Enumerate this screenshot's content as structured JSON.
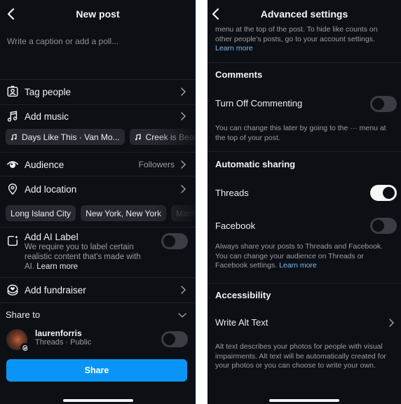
{
  "left": {
    "header": {
      "title": "New post",
      "back_icon": "chevron-left-icon"
    },
    "caption": {
      "placeholder": "Write a caption or add a poll..."
    },
    "rows": {
      "tag_people": {
        "label": "Tag people",
        "icon": "tag-person-icon"
      },
      "add_music": {
        "label": "Add music",
        "icon": "music-note-icon"
      },
      "audience": {
        "label": "Audience",
        "value": "Followers",
        "icon": "eye-icon"
      },
      "add_location": {
        "label": "Add location",
        "icon": "location-pin-icon"
      },
      "ai_label": {
        "label": "Add AI Label",
        "description": "We require you to label certain realistic content that's made with AI.",
        "link": "Learn more",
        "toggle_on": false,
        "icon": "sparkle-square-icon"
      },
      "fundraiser": {
        "label": "Add fundraiser",
        "icon": "fundraiser-icon"
      }
    },
    "music_chips": [
      {
        "label": "Days Like This · Van Mo..."
      },
      {
        "label": "Creek is Beauti"
      }
    ],
    "location_chips": [
      {
        "label": "Long Island City"
      },
      {
        "label": "New York, New York"
      },
      {
        "label": "Manha"
      }
    ],
    "share_to": {
      "label": "Share to",
      "account": {
        "name": "laurenforris",
        "subtitle": "Threads · Public",
        "toggle_on": false
      }
    },
    "share_button": {
      "label": "Share"
    }
  },
  "right": {
    "header": {
      "title": "Advanced settings",
      "back_icon": "chevron-left-icon"
    },
    "top_text": "menu at the top of the post. To hide like counts on other people's posts, go to your account settings.",
    "top_link": "Learn more",
    "comments": {
      "heading": "Comments",
      "turn_off_label": "Turn Off Commenting",
      "turn_off_on": false,
      "note": "You can change this later by going to the ··· menu at the top of your post."
    },
    "automatic_sharing": {
      "heading": "Automatic sharing",
      "threads_label": "Threads",
      "threads_on": true,
      "facebook_label": "Facebook",
      "facebook_on": false,
      "note": "Always share your posts to Threads and Facebook. You can change your audience on Threads or Facebook settings.",
      "link": "Learn more"
    },
    "accessibility": {
      "heading": "Accessibility",
      "alt_text_label": "Write Alt Text",
      "note": "Alt text describes your photos for people with visual impairments. Alt text will be automatically created for your photos or you can choose to write your own."
    }
  },
  "colors": {
    "background": "#0c0f14",
    "accent_blue": "#0a95f6",
    "link_blue": "#7fbcf1",
    "chip_bg": "#262a30",
    "toggle_off": "#3a3d43"
  }
}
